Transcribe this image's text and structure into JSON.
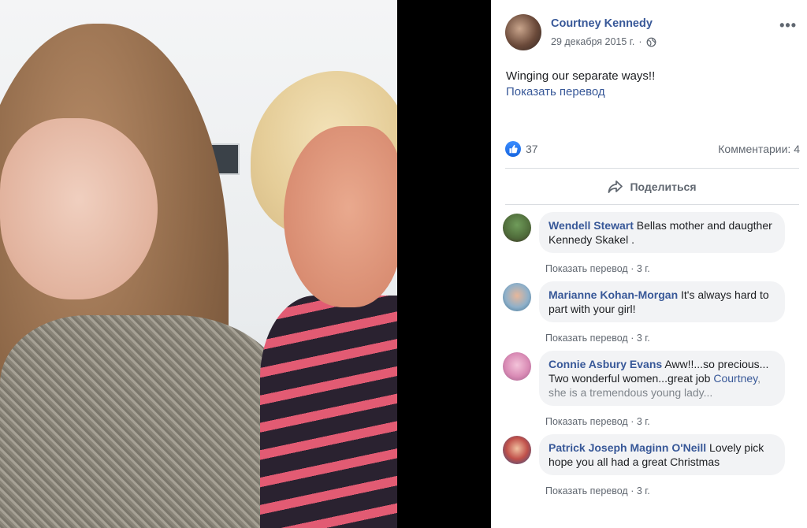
{
  "post": {
    "author": "Courtney Kennedy",
    "date": "29 декабря 2015 г.",
    "more_label": "•••",
    "text": "Winging our separate ways!!",
    "translate_label": "Показать перевод",
    "likes": "37",
    "comments_label": "Комментарии: 4",
    "share_label": "Поделиться"
  },
  "comments": [
    {
      "name": "Wendell Stewart",
      "text": "Bellas mother and daugther Kennedy Skakel .",
      "translate": "Показать перевод",
      "sep": " · ",
      "age": "3 г."
    },
    {
      "name": "Marianne Kohan-Morgan",
      "text": "It's always hard to part with your girl!",
      "translate": "Показать перевод",
      "sep": " · ",
      "age": "3 г."
    },
    {
      "name": "Connie Asbury Evans",
      "text_before": "Aww!!...so precious... Two wonderful women...great job",
      "mention": "Courtney",
      "text_after": ", she is a tremendous young lady...",
      "translate": "Показать перевод",
      "sep": " · ",
      "age": "3 г."
    },
    {
      "name": "Patrick Joseph Maginn O'Neill",
      "text": "Lovely pick hope you all had a great Christmas",
      "translate": "Показать перевод",
      "sep": " · ",
      "age": "3 г."
    }
  ],
  "colors": {
    "link": "#385898",
    "muted": "#606770",
    "bubble": "#f2f3f5",
    "like": "#1877f2"
  },
  "icons": [
    "globe-icon",
    "more-icon",
    "like-icon",
    "share-icon"
  ]
}
